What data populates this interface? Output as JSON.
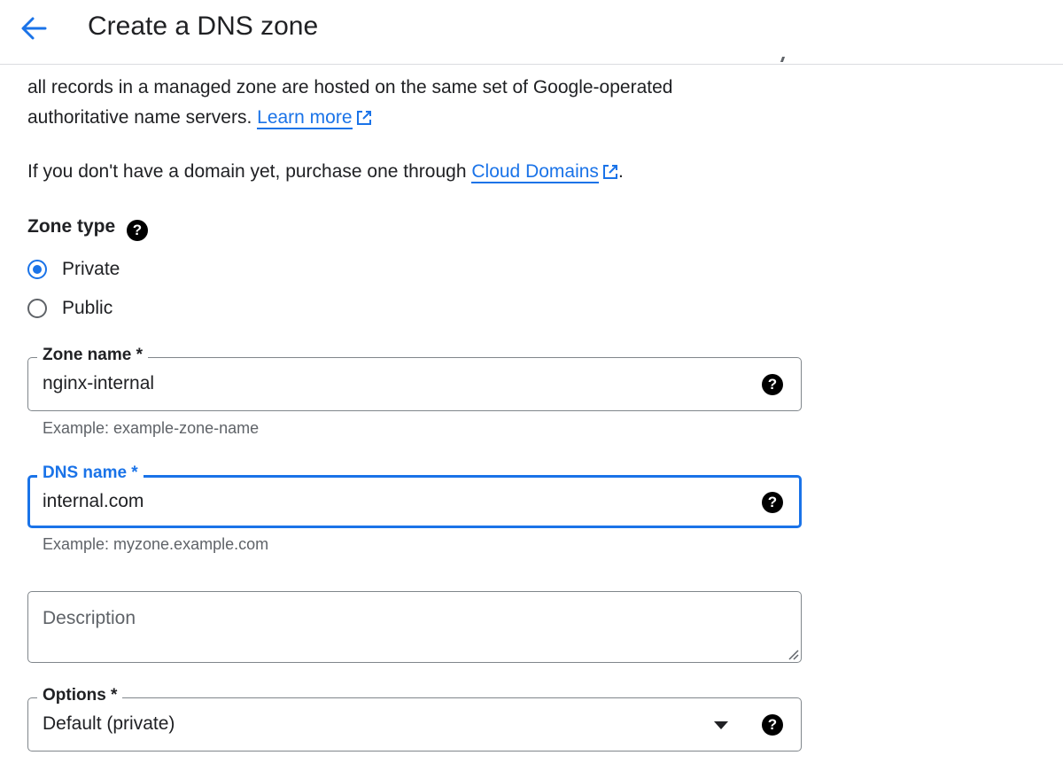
{
  "header": {
    "title": "Create a DNS zone",
    "back_icon": "arrow-back-icon"
  },
  "intro": {
    "line1": "all records in a managed zone are hosted on the same set of Google-operated",
    "line2": "authoritative name servers.",
    "learn_more": "Learn more",
    "domain_text": "If you don't have a domain yet, purchase one through",
    "cloud_domains": "Cloud Domains",
    "period": "."
  },
  "zone_type": {
    "label": "Zone type",
    "options": [
      {
        "label": "Private",
        "checked": true
      },
      {
        "label": "Public",
        "checked": false
      }
    ]
  },
  "zone_name": {
    "label": "Zone name *",
    "value": "nginx-internal",
    "hint": "Example: example-zone-name"
  },
  "dns_name": {
    "label": "DNS name *",
    "value": "internal.com",
    "hint": "Example: myzone.example.com"
  },
  "description": {
    "placeholder": "Description",
    "value": ""
  },
  "options": {
    "label": "Options *",
    "value": "Default (private)"
  },
  "help_glyph": "?",
  "colors": {
    "accent": "#1a73e8",
    "text": "#202124",
    "secondary": "#5f6368",
    "border": "#80868b"
  }
}
